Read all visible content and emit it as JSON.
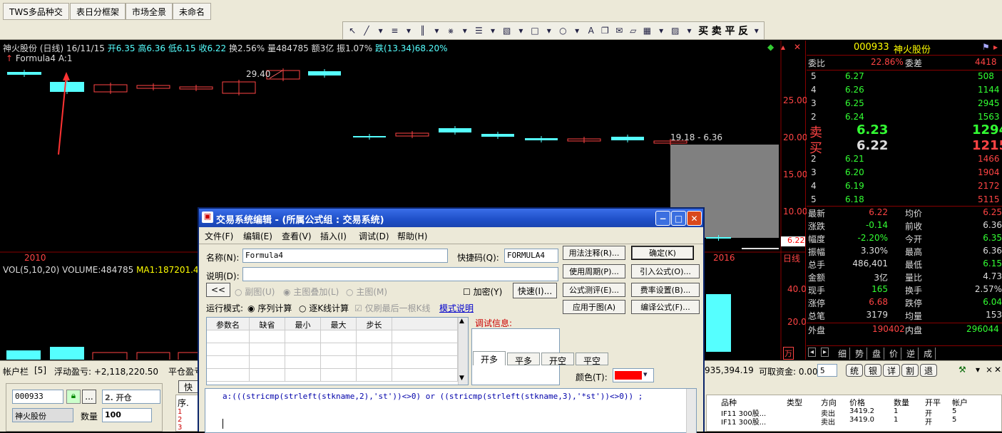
{
  "top_tabs": [
    "TWS多品种交",
    "表日分框架",
    "市场全景",
    "未命名"
  ],
  "toolbar": {
    "trade_buttons": [
      "买",
      "卖",
      "平",
      "反"
    ]
  },
  "chart": {
    "info_name": "神火股份 (日线)",
    "info_date": "16/11/15",
    "info_open": "开6.35",
    "info_high": "高6.36",
    "info_low": "低6.15",
    "info_close": "收6.22",
    "info_turnover": "换2.56%",
    "info_volume": "量484785",
    "info_amount": "额3亿",
    "info_amplitude": "振1.07%",
    "info_change": "跌(13.34)68.20%",
    "formula_name": "Formula4",
    "formula_value": "A:1",
    "peak_label": "29.40",
    "range_label": "19.18 - 6.36",
    "price_ticks": [
      "25.00",
      "20.00",
      "15.00",
      "10.00"
    ],
    "current_price_tag": "6.22",
    "x_labels": [
      "2010",
      "2016"
    ],
    "period_label": "日线",
    "vol_label": "VOL(5,10,20)",
    "vol_value": "VOLUME:484785",
    "vol_ma": "MA1:187201.4",
    "vol_tick": "40.0",
    "vol_tick2": "20.0",
    "vol_unit": "万"
  },
  "quote": {
    "code": "000933",
    "name": "神火股份",
    "weibi_label": "委比",
    "weibi_value": "22.86%",
    "weicha_label": "委差",
    "weicha_value": "4418",
    "sell_levels": [
      {
        "lvl": "5",
        "price": "6.27",
        "vol": "508"
      },
      {
        "lvl": "4",
        "price": "6.26",
        "vol": "1144"
      },
      {
        "lvl": "3",
        "price": "6.25",
        "vol": "2945"
      },
      {
        "lvl": "2",
        "price": "6.24",
        "vol": "1563"
      }
    ],
    "sell1_label": "卖",
    "sell1_price": "6.23",
    "sell1_vol": "1294",
    "buy1_label": "买",
    "buy1_price": "6.22",
    "buy1_vol": "1215",
    "buy_levels": [
      {
        "lvl": "2",
        "price": "6.21",
        "vol": "1466"
      },
      {
        "lvl": "3",
        "price": "6.20",
        "vol": "1904"
      },
      {
        "lvl": "4",
        "price": "6.19",
        "vol": "2172"
      },
      {
        "lvl": "5",
        "price": "6.18",
        "vol": "5115"
      }
    ],
    "stats": [
      {
        "l1": "最新",
        "v1": "6.22",
        "l2": "均价",
        "v2": "6.25",
        "c1": "red",
        "c2": "red"
      },
      {
        "l1": "涨跌",
        "v1": "-0.14",
        "l2": "前收",
        "v2": "6.36",
        "c1": "grn",
        "c2": "txtw"
      },
      {
        "l1": "幅度",
        "v1": "-2.20%",
        "l2": "今开",
        "v2": "6.35",
        "c1": "grn",
        "c2": "grn"
      },
      {
        "l1": "振幅",
        "v1": "3.30%",
        "l2": "最高",
        "v2": "6.36",
        "c1": "txtw",
        "c2": "txtw"
      },
      {
        "l1": "总手",
        "v1": "486,401",
        "l2": "最低",
        "v2": "6.15",
        "c1": "txtw",
        "c2": "grn"
      },
      {
        "l1": "金额",
        "v1": "3亿",
        "l2": "量比",
        "v2": "4.73",
        "c1": "txtw",
        "c2": "txtw"
      },
      {
        "l1": "现手",
        "v1": "165",
        "l2": "换手",
        "v2": "2.57%",
        "c1": "grn",
        "c2": "txtw"
      },
      {
        "l1": "涨停",
        "v1": "6.68",
        "l2": "跌停",
        "v2": "6.04",
        "c1": "red",
        "c2": "grn"
      },
      {
        "l1": "总笔",
        "v1": "3179",
        "l2": "均量",
        "v2": "153",
        "c1": "txtw",
        "c2": "txtw"
      }
    ],
    "outer_label": "外盘",
    "outer_value": "190402",
    "inner_label": "内盘",
    "inner_value": "296044",
    "bottom_tabs": [
      "细",
      "势",
      "盘",
      "价",
      "逆",
      "成"
    ]
  },
  "account": {
    "bar_title": "帐户栏",
    "bar_count": "[5]",
    "floating_pl": "浮动盈亏: +2,118,220.50",
    "close_pl_label": "平仓盈亏",
    "equity_fragment": "935,394.19",
    "available_label": "可取资金: 0.00",
    "page_select": "5",
    "ops": [
      "统",
      "银",
      "详",
      "割",
      "退"
    ],
    "code": "000933",
    "action": "2. 开仓",
    "stock_name": "神火股份",
    "qty_label": "数量",
    "qty_value": "100",
    "partial_tab": "快",
    "seq_header": "序.",
    "seq_rows": [
      "1",
      "2",
      "3"
    ],
    "order_headers": [
      "品种",
      "类型",
      "方向",
      "价格",
      "数量",
      "开平",
      "帐户"
    ],
    "orders": [
      {
        "sym": "IF11 300股...",
        "type": "",
        "dir": "卖出",
        "price": "3419.2",
        "qty": "1",
        "oc": "开",
        "acct": "5"
      },
      {
        "sym": "IF11 300股...",
        "type": "",
        "dir": "卖出",
        "price": "3419.0",
        "qty": "1",
        "oc": "开",
        "acct": "5"
      }
    ]
  },
  "dialog": {
    "title": "交易系统编辑 - (所属公式组 : 交易系统)",
    "menus": [
      "文件(F)",
      "编辑(E)",
      "查看(V)",
      "插入(I)",
      "调试(D)",
      "帮助(H)"
    ],
    "name_label": "名称(N):",
    "name_value": "Formula4",
    "shortcut_label": "快捷码(Q):",
    "shortcut_value": "FORMULA4",
    "desc_label": "说明(D):",
    "back_btn": "<<",
    "radio_sub": "副图(U)",
    "radio_overlay": "主图叠加(L)",
    "radio_main": "主图(M)",
    "encrypt_label": "加密(Y)",
    "fast_btn": "快速(I)...",
    "run_mode_label": "运行模式:",
    "seq_calc": "序列计算",
    "bar_calc": "逐K线计算",
    "last_bar": "仅刷最后一根K线",
    "mode_help": "模式说明",
    "debug_label": "调试信息:",
    "param_headers": [
      "参数名",
      "缺省",
      "最小",
      "最大",
      "步长"
    ],
    "right_btns": [
      "用法注释(R)...",
      "确定(K)",
      "使用周期(P)...",
      "引入公式(O)...",
      "公式测评(E)...",
      "费率设置(B)...",
      "应用于图(A)",
      "编译公式(F)..."
    ],
    "signal_tabs": [
      "开多",
      "平多",
      "开空",
      "平空"
    ],
    "color_label": "颜色(T):",
    "color_value": "#ff0000",
    "code": "a:(((stricmp(strleft(stkname,2),'st'))<>0) or ((stricmp(strleft(stkname,3),'*st'))<>0)) ;"
  }
}
